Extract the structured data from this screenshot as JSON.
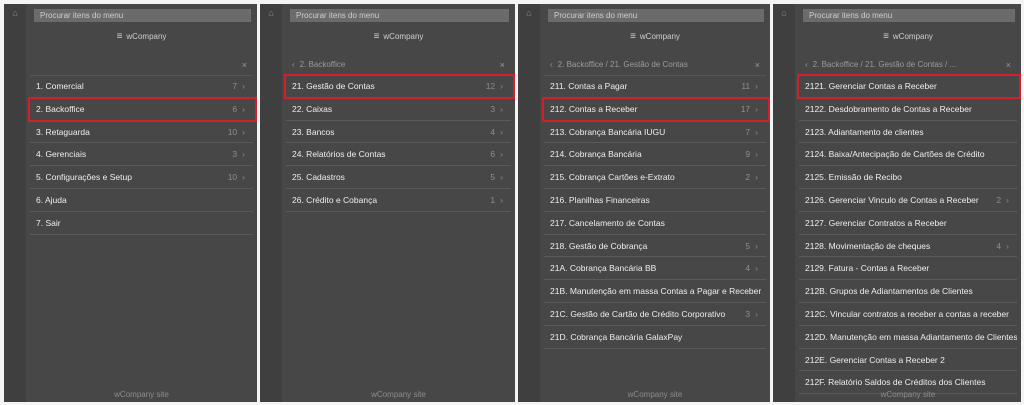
{
  "common": {
    "search_placeholder": "Procurar itens do menu",
    "brand": "wCompany",
    "footer": "wCompany site",
    "home_icon": "home-icon",
    "highlight_color": "#d0202a"
  },
  "panels": [
    {
      "breadcrumb": "",
      "items": [
        {
          "label": "1. Comercial",
          "count": "7"
        },
        {
          "label": "2. Backoffice",
          "count": "6"
        },
        {
          "label": "3. Retaguarda",
          "count": "10"
        },
        {
          "label": "4. Gerenciais",
          "count": "3"
        },
        {
          "label": "5. Configurações e Setup",
          "count": "10"
        },
        {
          "label": "6. Ajuda",
          "count": ""
        },
        {
          "label": "7. Sair",
          "count": ""
        }
      ],
      "selected_index": 1
    },
    {
      "breadcrumb": "2. Backoffice",
      "items": [
        {
          "label": "21. Gestão de Contas",
          "count": "12"
        },
        {
          "label": "22. Caixas",
          "count": "3"
        },
        {
          "label": "23. Bancos",
          "count": "4"
        },
        {
          "label": "24. Relatórios de Contas",
          "count": "6"
        },
        {
          "label": "25. Cadastros",
          "count": "5"
        },
        {
          "label": "26. Crédito e Cobança",
          "count": "1"
        }
      ],
      "selected_index": 0
    },
    {
      "breadcrumb": "2. Backoffice / 21. Gestão de Contas",
      "items": [
        {
          "label": "211. Contas a Pagar",
          "count": "11"
        },
        {
          "label": "212. Contas a Receber",
          "count": "17"
        },
        {
          "label": "213. Cobrança Bancária IUGU",
          "count": "7"
        },
        {
          "label": "214. Cobrança Bancária",
          "count": "9"
        },
        {
          "label": "215. Cobrança Cartões e-Extrato",
          "count": "2"
        },
        {
          "label": "216. Planilhas Financeiras",
          "count": ""
        },
        {
          "label": "217. Cancelamento de Contas",
          "count": ""
        },
        {
          "label": "218. Gestão de Cobrança",
          "count": "5"
        },
        {
          "label": "21A. Cobrança Bancária BB",
          "count": "4"
        },
        {
          "label": "21B. Manutenção em massa Contas a Pagar e Receber",
          "count": ""
        },
        {
          "label": "21C. Gestão de Cartão de Crédito Corporativo",
          "count": "3"
        },
        {
          "label": "21D. Cobrança Bancária GalaxPay",
          "count": ""
        }
      ],
      "selected_index": 1
    },
    {
      "breadcrumb": "2. Backoffice / 21. Gestão de Contas / ...",
      "items": [
        {
          "label": "2121. Gerenciar Contas a Receber",
          "count": ""
        },
        {
          "label": "2122. Desdobramento de Contas a Receber",
          "count": ""
        },
        {
          "label": "2123. Adiantamento de clientes",
          "count": ""
        },
        {
          "label": "2124. Baixa/Antecipação de Cartões de Crédito",
          "count": ""
        },
        {
          "label": "2125. Emissão de Recibo",
          "count": ""
        },
        {
          "label": "2126. Gerenciar Vinculo de Contas a Receber",
          "count": "2"
        },
        {
          "label": "2127. Gerenciar Contratos a Receber",
          "count": ""
        },
        {
          "label": "2128. Movimentação de cheques",
          "count": "4"
        },
        {
          "label": "2129. Fatura - Contas a Receber",
          "count": ""
        },
        {
          "label": "212B. Grupos de Adiantamentos de Clientes",
          "count": ""
        },
        {
          "label": "212C. Vincular contratos a receber a contas a receber",
          "count": ""
        },
        {
          "label": "212D. Manutenção em massa Adiantamento de Clientes",
          "count": ""
        },
        {
          "label": "212E. Gerenciar Contas a Receber 2",
          "count": ""
        },
        {
          "label": "212F. Relatório Saldos de Créditos dos Clientes",
          "count": ""
        }
      ],
      "selected_index": 0
    }
  ]
}
